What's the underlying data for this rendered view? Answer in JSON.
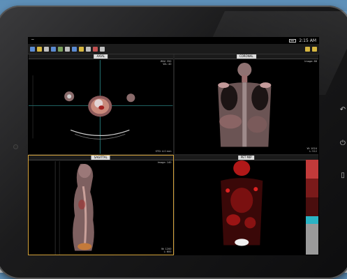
{
  "status": {
    "time": "2:15 AM"
  },
  "toolbar": {
    "icons": [
      "pan-icon",
      "zoom-icon",
      "window-level-icon",
      "rotate-icon",
      "flip-icon",
      "measure-icon",
      "angle-icon",
      "annotate-icon",
      "cine-icon",
      "layout-icon",
      "reset-icon",
      "settings-icon"
    ]
  },
  "viewports": [
    {
      "series": "AXIAL",
      "tr": "WW: 350\nWL: 40",
      "br": "STD: 4.0 mm"
    },
    {
      "series": "CORONAL",
      "tr": "Image: 88",
      "br": "W: 1024\nL: 512"
    },
    {
      "series": "SAGITTAL",
      "tr": "Image: 140",
      "br": "W: 1200\nL: 600"
    },
    {
      "series": "PET MIP",
      "tr": "",
      "br": ""
    }
  ],
  "colors": {
    "accent": "#d4a23a",
    "screen_bg": "#000000",
    "colorbar": [
      "#c23a3a",
      "#7a1a1a",
      "#4a0e0e",
      "#2ab3c4",
      "#9a9a9a"
    ]
  }
}
